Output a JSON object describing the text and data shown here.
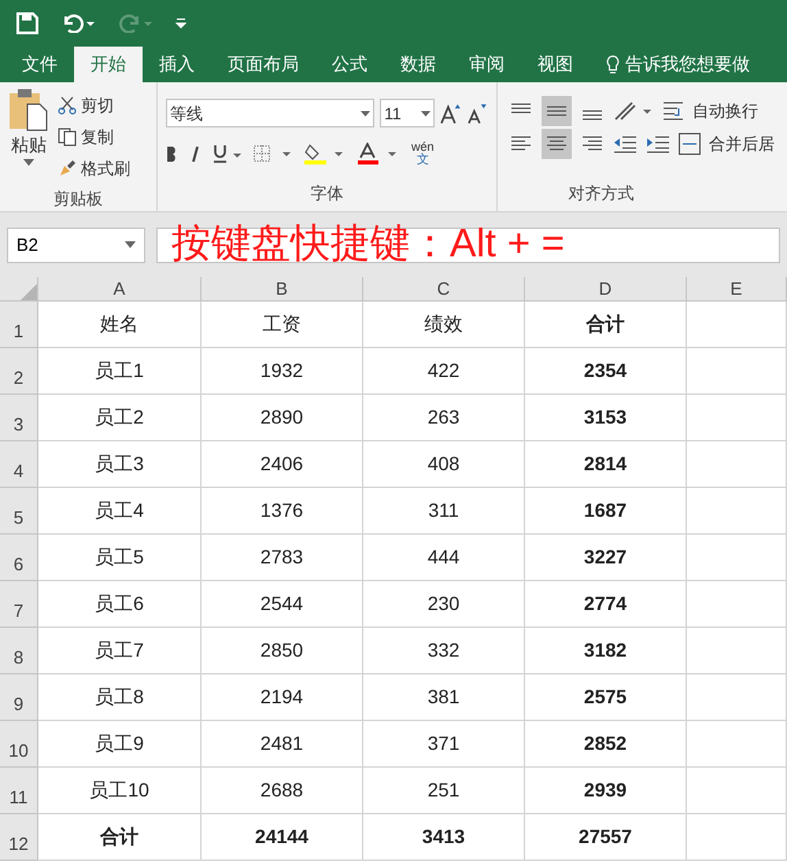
{
  "tabs": [
    {
      "label": "文件",
      "selected": false
    },
    {
      "label": "开始",
      "selected": true
    },
    {
      "label": "插入",
      "selected": false
    },
    {
      "label": "页面布局",
      "selected": false
    },
    {
      "label": "公式",
      "selected": false
    },
    {
      "label": "数据",
      "selected": false
    },
    {
      "label": "审阅",
      "selected": false
    },
    {
      "label": "视图",
      "selected": false
    }
  ],
  "tell_me": "告诉我您想要做",
  "clipboard": {
    "paste": "粘贴",
    "items": [
      "剪切",
      "复制",
      "格式刷"
    ],
    "group_label": "剪贴板"
  },
  "font": {
    "name": "等线",
    "size": "11",
    "phonetic_top": "wén",
    "phonetic_bottom": "文",
    "group_label": "字体"
  },
  "alignment": {
    "wrap": "自动换行",
    "merge": "合并后居",
    "group_label": "对齐方式"
  },
  "name_box": "B2",
  "annotation": "按键盘快捷键：Alt + =",
  "columns": [
    "A",
    "B",
    "C",
    "D",
    "E"
  ],
  "rows": [
    {
      "header": "1",
      "cells": [
        {
          "text": "姓名",
          "bold": false
        },
        {
          "text": "工资",
          "bold": false
        },
        {
          "text": "绩效",
          "bold": false
        },
        {
          "text": "合计",
          "bold": true
        }
      ]
    },
    {
      "header": "2",
      "cells": [
        {
          "text": "员工1",
          "bold": false
        },
        {
          "text": "1932",
          "bold": false
        },
        {
          "text": "422",
          "bold": false
        },
        {
          "text": "2354",
          "bold": true
        }
      ]
    },
    {
      "header": "3",
      "cells": [
        {
          "text": "员工2",
          "bold": false
        },
        {
          "text": "2890",
          "bold": false
        },
        {
          "text": "263",
          "bold": false
        },
        {
          "text": "3153",
          "bold": true
        }
      ]
    },
    {
      "header": "4",
      "cells": [
        {
          "text": "员工3",
          "bold": false
        },
        {
          "text": "2406",
          "bold": false
        },
        {
          "text": "408",
          "bold": false
        },
        {
          "text": "2814",
          "bold": true
        }
      ]
    },
    {
      "header": "5",
      "cells": [
        {
          "text": "员工4",
          "bold": false
        },
        {
          "text": "1376",
          "bold": false
        },
        {
          "text": "311",
          "bold": false
        },
        {
          "text": "1687",
          "bold": true
        }
      ]
    },
    {
      "header": "6",
      "cells": [
        {
          "text": "员工5",
          "bold": false
        },
        {
          "text": "2783",
          "bold": false
        },
        {
          "text": "444",
          "bold": false
        },
        {
          "text": "3227",
          "bold": true
        }
      ]
    },
    {
      "header": "7",
      "cells": [
        {
          "text": "员工6",
          "bold": false
        },
        {
          "text": "2544",
          "bold": false
        },
        {
          "text": "230",
          "bold": false
        },
        {
          "text": "2774",
          "bold": true
        }
      ]
    },
    {
      "header": "8",
      "cells": [
        {
          "text": "员工7",
          "bold": false
        },
        {
          "text": "2850",
          "bold": false
        },
        {
          "text": "332",
          "bold": false
        },
        {
          "text": "3182",
          "bold": true
        }
      ]
    },
    {
      "header": "9",
      "cells": [
        {
          "text": "员工8",
          "bold": false
        },
        {
          "text": "2194",
          "bold": false
        },
        {
          "text": "381",
          "bold": false
        },
        {
          "text": "2575",
          "bold": true
        }
      ]
    },
    {
      "header": "10",
      "cells": [
        {
          "text": "员工9",
          "bold": false
        },
        {
          "text": "2481",
          "bold": false
        },
        {
          "text": "371",
          "bold": false
        },
        {
          "text": "2852",
          "bold": true
        }
      ]
    },
    {
      "header": "11",
      "cells": [
        {
          "text": "员工10",
          "bold": false
        },
        {
          "text": "2688",
          "bold": false
        },
        {
          "text": "251",
          "bold": false
        },
        {
          "text": "2939",
          "bold": true
        }
      ]
    },
    {
      "header": "12",
      "cells": [
        {
          "text": "合计",
          "bold": true
        },
        {
          "text": "24144",
          "bold": true
        },
        {
          "text": "3413",
          "bold": true
        },
        {
          "text": "27557",
          "bold": true
        }
      ]
    }
  ]
}
